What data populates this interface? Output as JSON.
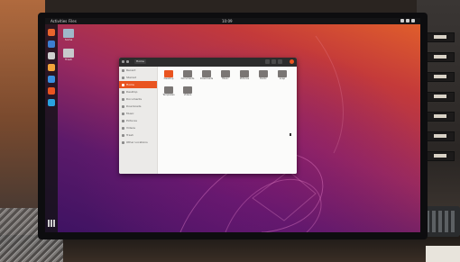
{
  "desktop": {
    "top_bar": {
      "activities": "Activities",
      "app_menu": "Files",
      "clock": "10:09"
    },
    "dock_icons": [
      {
        "name": "firefox-icon",
        "color": "#e9652d"
      },
      {
        "name": "thunderbird-icon",
        "color": "#3c7fd1"
      },
      {
        "name": "files-icon",
        "color": "#cfcfcf"
      },
      {
        "name": "rhythmbox-icon",
        "color": "#f2a33a"
      },
      {
        "name": "writer-icon",
        "color": "#3a8fe0"
      },
      {
        "name": "software-icon",
        "color": "#e95420"
      },
      {
        "name": "help-icon",
        "color": "#2aa3e0"
      }
    ],
    "desktop_icons": [
      {
        "name": "home-folder",
        "label": "home",
        "color": "#9fb8c9"
      },
      {
        "name": "trash",
        "label": "Trash",
        "color": "#c7c9cc"
      }
    ]
  },
  "file_manager": {
    "path": "Home",
    "sidebar": [
      {
        "label": "Recent",
        "active": false
      },
      {
        "label": "Starred",
        "active": false
      },
      {
        "label": "Home",
        "active": true
      },
      {
        "label": "Desktop",
        "active": false
      },
      {
        "label": "Documents",
        "active": false
      },
      {
        "label": "Downloads",
        "active": false
      },
      {
        "label": "Music",
        "active": false
      },
      {
        "label": "Pictures",
        "active": false
      },
      {
        "label": "Videos",
        "active": false
      },
      {
        "label": "Trash",
        "active": false
      },
      {
        "label": "Other Locations",
        "active": false
      }
    ],
    "folders": [
      {
        "label": "Desktop",
        "kind": "home"
      },
      {
        "label": "Documents",
        "kind": "folder"
      },
      {
        "label": "Downloads",
        "kind": "folder"
      },
      {
        "label": "Music",
        "kind": "folder"
      },
      {
        "label": "Pictures",
        "kind": "folder"
      },
      {
        "label": "Public",
        "kind": "folder"
      },
      {
        "label": "snap",
        "kind": "folder"
      },
      {
        "label": "Templates",
        "kind": "folder"
      },
      {
        "label": "Videos",
        "kind": "folder"
      }
    ]
  }
}
